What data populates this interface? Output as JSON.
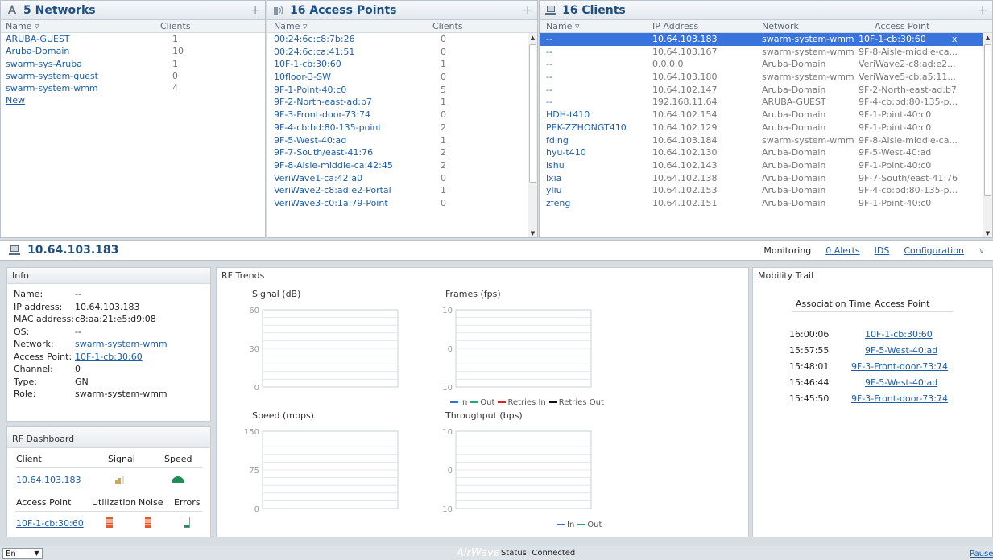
{
  "networks": {
    "title": "5 Networks",
    "col_name": "Name",
    "col_clients": "Clients",
    "rows": [
      {
        "name": "ARUBA-GUEST",
        "clients": "1"
      },
      {
        "name": "Aruba-Domain",
        "clients": "10"
      },
      {
        "name": "swarm-sys-Aruba",
        "clients": "1"
      },
      {
        "name": "swarm-system-guest",
        "clients": "0"
      },
      {
        "name": "swarm-system-wmm",
        "clients": "4"
      }
    ],
    "new_label": "New"
  },
  "access_points": {
    "title": "16 Access Points",
    "col_name": "Name",
    "col_clients": "Clients",
    "rows": [
      {
        "name": "00:24:6c:c8:7b:26",
        "clients": "0"
      },
      {
        "name": "00:24:6c:ca:41:51",
        "clients": "0"
      },
      {
        "name": "10F-1-cb:30:60",
        "clients": "1"
      },
      {
        "name": "10floor-3-SW",
        "clients": "0"
      },
      {
        "name": "9F-1-Point-40:c0",
        "clients": "5"
      },
      {
        "name": "9F-2-North-east-ad:b7",
        "clients": "1"
      },
      {
        "name": "9F-3-Front-door-73:74",
        "clients": "0"
      },
      {
        "name": "9F-4-cb:bd:80-135-point",
        "clients": "2"
      },
      {
        "name": "9F-5-West-40:ad",
        "clients": "1"
      },
      {
        "name": "9F-7-South/east-41:76",
        "clients": "2"
      },
      {
        "name": "9F-8-Aisle-middle-ca:42:45",
        "clients": "2"
      },
      {
        "name": "VeriWave1-ca:42:a0",
        "clients": "0"
      },
      {
        "name": "VeriWave2-c8:ad:e2-Portal",
        "clients": "1"
      },
      {
        "name": "VeriWave3-c0:1a:79-Point",
        "clients": "0"
      }
    ]
  },
  "clients": {
    "title": "16 Clients",
    "col_name": "Name",
    "col_ip": "IP Address",
    "col_network": "Network",
    "col_ap": "Access Point",
    "selected_close": "x",
    "rows": [
      {
        "name": "--",
        "ip": "10.64.103.183",
        "network": "swarm-system-wmm",
        "ap": "10F-1-cb:30:60"
      },
      {
        "name": "--",
        "ip": "10.64.103.167",
        "network": "swarm-system-wmm",
        "ap": "9F-8-Aisle-middle-ca..."
      },
      {
        "name": "--",
        "ip": "0.0.0.0",
        "network": "Aruba-Domain",
        "ap": "VeriWave2-c8:ad:e2..."
      },
      {
        "name": "--",
        "ip": "10.64.103.180",
        "network": "swarm-system-wmm",
        "ap": "VeriWave5-cb:a5:11..."
      },
      {
        "name": "--",
        "ip": "10.64.102.147",
        "network": "Aruba-Domain",
        "ap": "9F-2-North-east-ad:b7"
      },
      {
        "name": "--",
        "ip": "192.168.11.64",
        "network": "ARUBA-GUEST",
        "ap": "9F-4-cb:bd:80-135-p..."
      },
      {
        "name": "HDH-t410",
        "ip": "10.64.102.154",
        "network": "Aruba-Domain",
        "ap": "9F-1-Point-40:c0"
      },
      {
        "name": "PEK-ZZHONGT410",
        "ip": "10.64.102.129",
        "network": "Aruba-Domain",
        "ap": "9F-1-Point-40:c0"
      },
      {
        "name": "fding",
        "ip": "10.64.103.184",
        "network": "swarm-system-wmm",
        "ap": "9F-8-Aisle-middle-ca..."
      },
      {
        "name": "hyu-t410",
        "ip": "10.64.102.130",
        "network": "Aruba-Domain",
        "ap": "9F-5-West-40:ad"
      },
      {
        "name": "lshu",
        "ip": "10.64.102.143",
        "network": "Aruba-Domain",
        "ap": "9F-1-Point-40:c0"
      },
      {
        "name": "lxia",
        "ip": "10.64.102.138",
        "network": "Aruba-Domain",
        "ap": "9F-7-South/east-41:76"
      },
      {
        "name": "yliu",
        "ip": "10.64.102.153",
        "network": "Aruba-Domain",
        "ap": "9F-4-cb:bd:80-135-p..."
      },
      {
        "name": "zfeng",
        "ip": "10.64.102.151",
        "network": "Aruba-Domain",
        "ap": "9F-1-Point-40:c0"
      }
    ]
  },
  "detail": {
    "title": "10.64.103.183",
    "nav": {
      "monitoring": "Monitoring",
      "alerts": "0 Alerts",
      "ids": "IDS",
      "configuration": "Configuration"
    }
  },
  "info": {
    "title": "Info",
    "fields": [
      {
        "label": "Name:",
        "value": "--",
        "link": false
      },
      {
        "label": "IP address:",
        "value": "10.64.103.183",
        "link": false
      },
      {
        "label": "MAC address:",
        "value": "c8:aa:21:e5:d9:08",
        "link": false
      },
      {
        "label": "OS:",
        "value": "--",
        "link": false
      },
      {
        "label": "Network:",
        "value": "swarm-system-wmm",
        "link": true
      },
      {
        "label": "Access Point:",
        "value": "10F-1-cb:30:60",
        "link": true
      },
      {
        "label": "Channel:",
        "value": "0",
        "link": false
      },
      {
        "label": "Type:",
        "value": "GN",
        "link": false
      },
      {
        "label": "Role:",
        "value": "swarm-system-wmm",
        "link": false
      }
    ]
  },
  "rf_dashboard": {
    "title": "RF Dashboard",
    "client_hdr": "Client",
    "signal_hdr": "Signal",
    "speed_hdr": "Speed",
    "client_value": "10.64.103.183",
    "ap_hdr": "Access Point",
    "util_hdr": "Utilization",
    "noise_hdr": "Noise",
    "errors_hdr": "Errors",
    "ap_value": "10F-1-cb:30:60"
  },
  "rf_trends": {
    "title": "RF Trends",
    "signal": {
      "title": "Signal  (dB)",
      "ticks": [
        "60",
        "30",
        "0"
      ]
    },
    "frames": {
      "title": "Frames  (fps)",
      "ticks": [
        "10",
        "0",
        "10"
      ]
    },
    "speed": {
      "title": "Speed  (mbps)",
      "ticks": [
        "150",
        "75",
        "0"
      ]
    },
    "throughput": {
      "title": "Throughput  (bps)",
      "ticks": [
        "10",
        "0",
        "10"
      ]
    },
    "legend_frames": [
      {
        "label": "In",
        "color": "#2f6fd6"
      },
      {
        "label": "Out",
        "color": "#27a37a"
      },
      {
        "label": "Retries In",
        "color": "#e02020"
      },
      {
        "label": "Retries Out",
        "color": "#111111"
      }
    ],
    "legend_throughput": [
      {
        "label": "In",
        "color": "#2f6fd6"
      },
      {
        "label": "Out",
        "color": "#27a37a"
      }
    ]
  },
  "mobility": {
    "title": "Mobility Trail",
    "col_time": "Association Time",
    "col_ap": "Access Point",
    "rows": [
      {
        "time": "16:00:06",
        "ap": "10F-1-cb:30:60"
      },
      {
        "time": "15:57:55",
        "ap": "9F-5-West-40:ad"
      },
      {
        "time": "15:48:01",
        "ap": "9F-3-Front-door-73:74"
      },
      {
        "time": "15:46:44",
        "ap": "9F-5-West-40:ad"
      },
      {
        "time": "15:45:50",
        "ap": "9F-3-Front-door-73:74"
      }
    ]
  },
  "footer": {
    "lang": "En",
    "brand": "AirWave",
    "status": "Status: Connected",
    "pause": "Pause"
  }
}
